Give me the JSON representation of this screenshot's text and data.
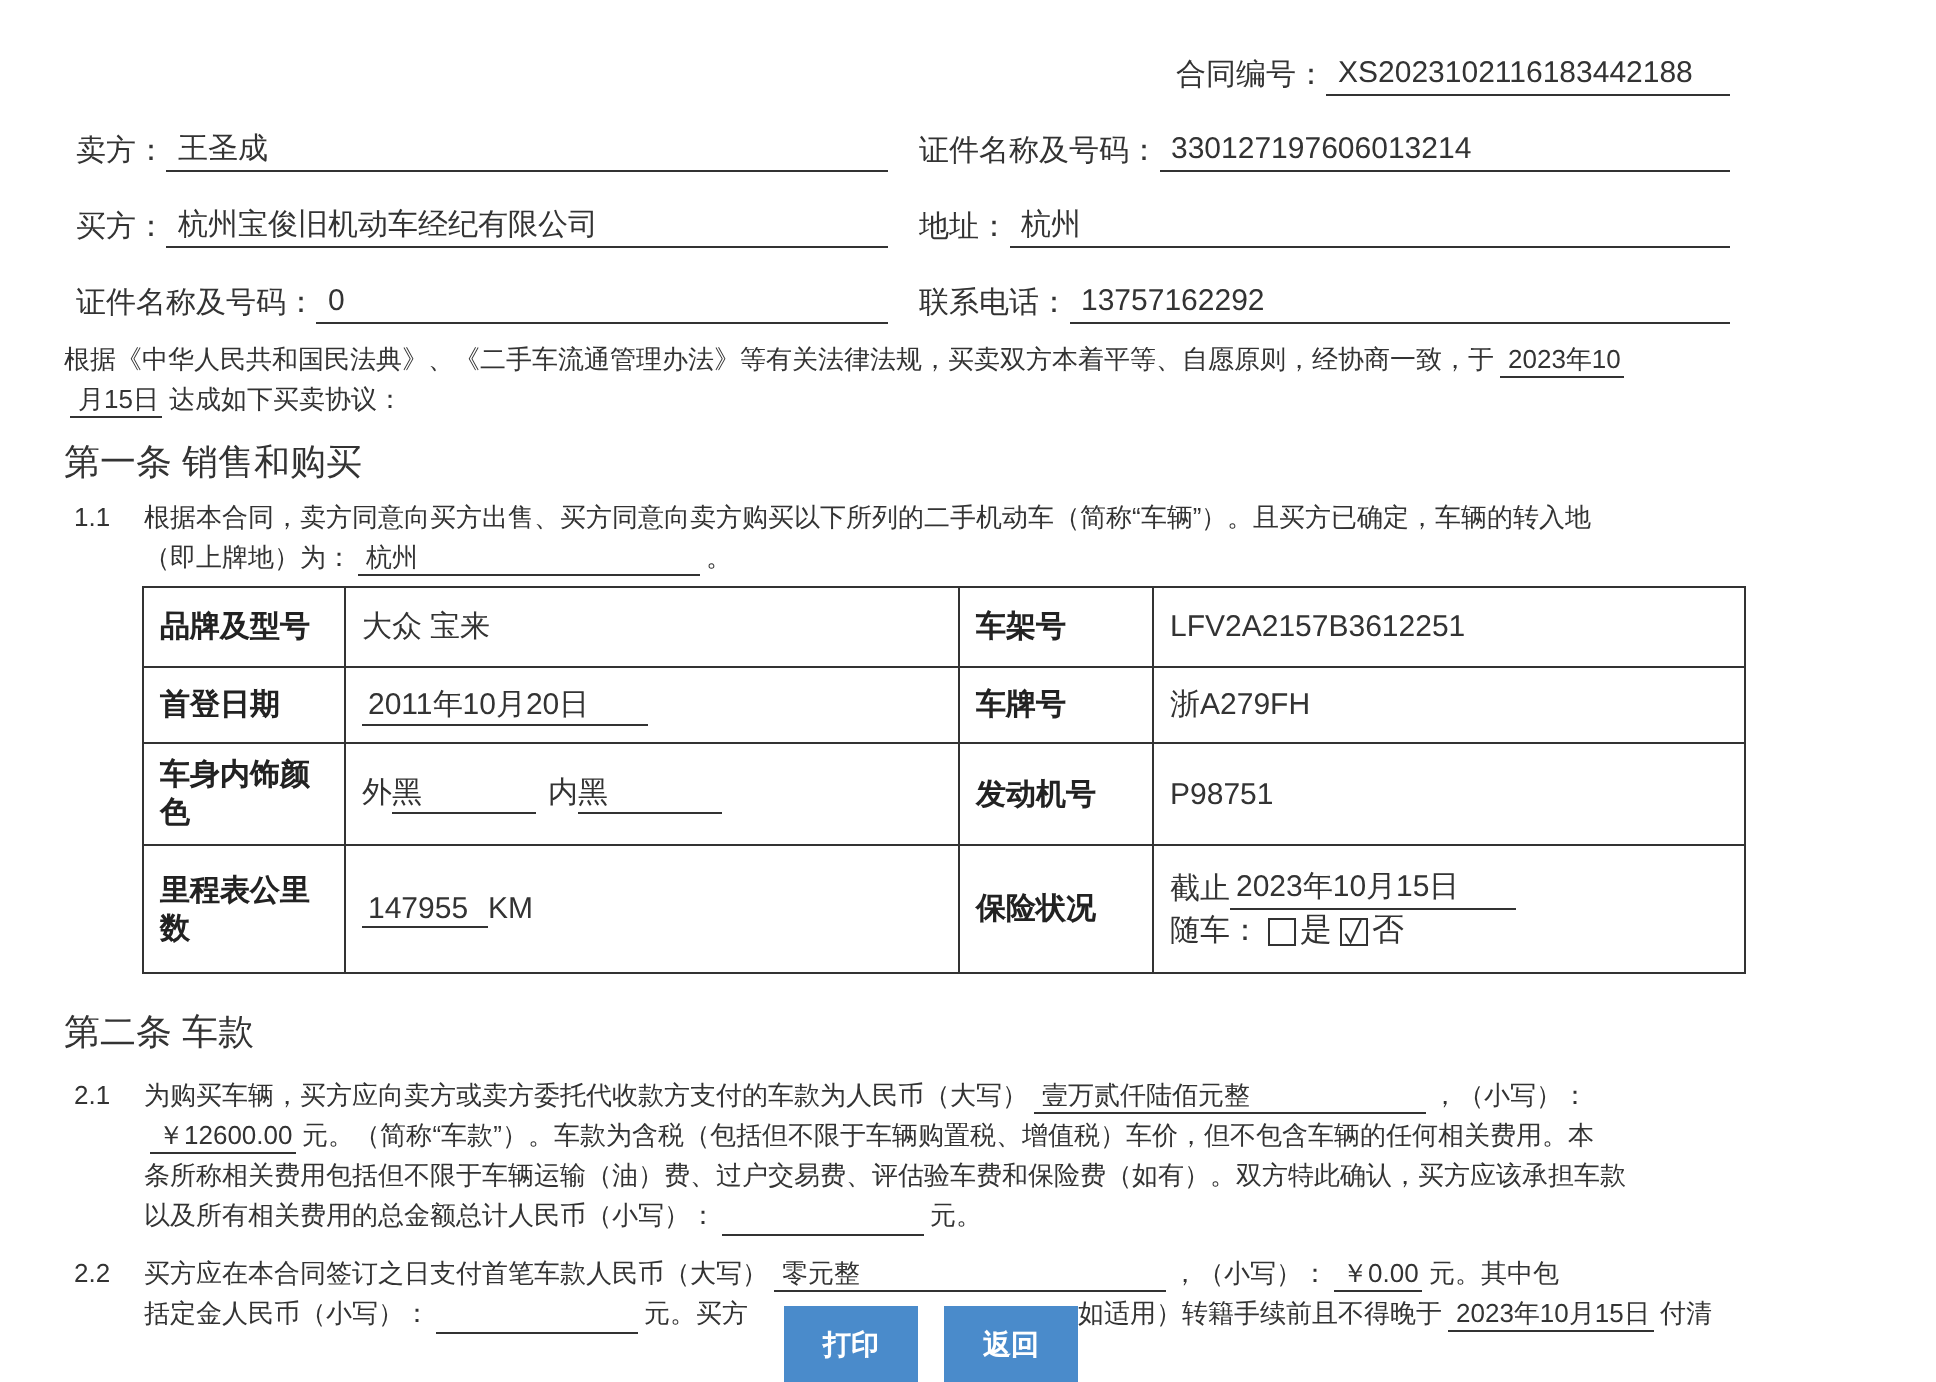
{
  "contract_no": {
    "label": "合同编号：",
    "value": "XS2023102116183442188"
  },
  "parties": [
    [
      {
        "label": "卖方：",
        "value": "王圣成"
      },
      {
        "label": "证件名称及号码：",
        "value": "330127197606013214"
      }
    ],
    [
      {
        "label": "买方：",
        "value": "杭州宝俊旧机动车经纪有限公司"
      },
      {
        "label": "地址：",
        "value": "杭州"
      }
    ],
    [
      {
        "label": "证件名称及号码：",
        "value": "0"
      },
      {
        "label": "联系电话：",
        "value": "13757162292"
      }
    ]
  ],
  "preamble": [
    [
      {
        "kind": "text",
        "text": "根据《中华人民共和国民法典》、《二手车流通管理办法》等有关法律法规，买卖双方本着平等、自愿原则，经协商一致，于"
      },
      {
        "kind": "fill",
        "text": "2023年10"
      }
    ],
    [
      {
        "kind": "fill",
        "text": "月15日"
      },
      {
        "kind": "text",
        "text": "达成如下买卖协议："
      }
    ]
  ],
  "section1": {
    "heading": "第一条 销售和购买",
    "clause": {
      "number": "1.1",
      "lines": [
        [
          {
            "kind": "text",
            "text": "根据本合同，卖方同意向买方出售、买方同意向卖方购买以下所列的二手机动车（简称“车辆”）。且买方已确定，车辆的转入地"
          }
        ],
        [
          {
            "kind": "text",
            "text": "（即上牌地）为："
          },
          {
            "kind": "fill",
            "text": "杭州"
          },
          {
            "kind": "text",
            "text": "。"
          }
        ]
      ]
    },
    "table": [
      {
        "left_label": "品牌及型号",
        "left": {
          "kind": "text",
          "text": "大众 宝来"
        },
        "right_label": "车架号",
        "right": {
          "kind": "text",
          "text": "LFV2A2157B3612251"
        }
      },
      {
        "left_label": "首登日期",
        "left": {
          "kind": "underline",
          "text": "2011年10月20日"
        },
        "right_label": "车牌号",
        "right": {
          "kind": "text",
          "text": "浙A279FH"
        }
      },
      {
        "left_label": "车身内饰颜色",
        "left": {
          "kind": "colors",
          "parts": [
            {
              "label": "外",
              "value": "黑"
            },
            {
              "label": "内",
              "value": "黑"
            }
          ]
        },
        "right_label": "发动机号",
        "right": {
          "kind": "text",
          "text": "P98751"
        }
      },
      {
        "left_label": "里程表公里数",
        "left": {
          "kind": "underline",
          "text": "147955",
          "suffix": "KM"
        },
        "right_label": "保险状况",
        "right": {
          "kind": "insurance",
          "label": "截止",
          "date": "2023年10月15日",
          "with_car": "随车：",
          "options": [
            {
              "label": "是",
              "checked": false
            },
            {
              "label": "否",
              "checked": true
            }
          ]
        }
      }
    ]
  },
  "section2": {
    "heading": "第二条 车款",
    "clauses": [
      {
        "number": "2.1",
        "lines": [
          [
            {
              "kind": "text",
              "text": "为购买车辆，买方应向卖方或卖方委托代收款方支付的车款为人民币（大写）"
            },
            {
              "kind": "wide_fill",
              "text": "壹万贰仟陆佰元整"
            },
            {
              "kind": "text",
              "text": "，（小写）："
            }
          ],
          [
            {
              "kind": "fill",
              "text": "￥12600.00"
            },
            {
              "kind": "text",
              "text": "元。（简称“车款”）。车款为含税（包括但不限于车辆购置税、增值税）车价，但不包含车辆的任何相关费用。本"
            }
          ],
          [
            {
              "kind": "text",
              "text": "条所称相关费用包括但不限于车辆运输（油）费、过户交易费、评估验车费和保险费（如有）。双方特此确认，买方应该承担车款"
            }
          ],
          [
            {
              "kind": "text",
              "text": "以及所有相关费用的总金额总计人民币（小写）："
            },
            {
              "kind": "blank"
            },
            {
              "kind": "text",
              "text": "元。"
            }
          ]
        ]
      },
      {
        "number": "2.2",
        "lines": [
          [
            {
              "kind": "text",
              "text": "买方应在本合同签订之日支付首笔车款人民币（大写）"
            },
            {
              "kind": "wide_fill",
              "text": "零元整"
            },
            {
              "kind": "text",
              "text": "，（小写）："
            },
            {
              "kind": "fill",
              "text": "￥0.00"
            },
            {
              "kind": "text",
              "text": "元。其中包"
            }
          ],
          [
            {
              "kind": "text",
              "text": "括定金人民币（小写）："
            },
            {
              "kind": "blank"
            },
            {
              "kind": "text",
              "text": "元。买方"
            },
            {
              "kind": "covered"
            },
            {
              "kind": "text",
              "text": "如适用）转籍手续前且不得晚于"
            },
            {
              "kind": "fill",
              "text": "2023年10月15日"
            },
            {
              "kind": "text",
              "text": "付清"
            }
          ]
        ]
      }
    ]
  },
  "buttons": [
    {
      "label": "打印"
    },
    {
      "label": "返回"
    }
  ]
}
